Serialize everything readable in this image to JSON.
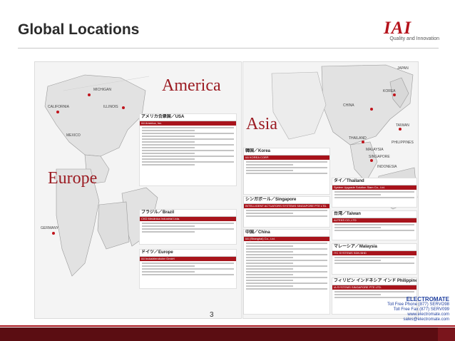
{
  "slide": {
    "title": "Global Locations",
    "page_number": "3",
    "brand_mark": "IAI",
    "brand_tagline": "Quality and Innovation"
  },
  "left_page": {
    "america_heading": "America",
    "europe_heading": "Europe",
    "map_labels": [
      "CALIFORNIA",
      "ILLINOIS",
      "MEXICO",
      "MICHIGAN",
      "GERMANY"
    ],
    "cards": [
      {
        "heading": "アメリカ合衆国／USA",
        "bar": "IAI America, Inc."
      },
      {
        "heading": "ブラジル／Brazil",
        "bar": "CKD Mecânica Industrial Ltda."
      },
      {
        "heading": "ドイツ／Europe",
        "bar": "IAI Industrieroboter GmbH"
      }
    ]
  },
  "right_page": {
    "asia_heading": "Asia",
    "map_labels": [
      "JAPAN",
      "KOREA",
      "CHINA",
      "TAIWAN",
      "THAILAND",
      "MALAYSIA",
      "PHILIPPINES",
      "SINGAPORE",
      "INDONESIA"
    ],
    "cards": [
      {
        "heading": "韓国／Korea",
        "bar": "IAI KOREA CORP."
      },
      {
        "heading": "シンガポール／Singapore",
        "bar": "INTELLIGENT ACTUATORS SYSTEMS SINGAPORE PTE LTD."
      },
      {
        "heading": "中国／China",
        "bar": "IAI (Shanghai) Co., Ltd."
      },
      {
        "heading": "タイ／Thailand",
        "bar": "System Upgrade Solution Siam Co., Ltd."
      },
      {
        "heading": "台湾／Taiwan",
        "bar": "ALTEKS CO.,LTD"
      },
      {
        "heading": "マレーシア／Malaysia",
        "bar": "ITC SYSTEMS SDN BHD"
      },
      {
        "heading": "フィリピン インドネシア インド Philippines Indonesia India",
        "bar": "IA SYSTEMS SINGAPORE PTE LTD."
      }
    ]
  },
  "electromate": {
    "name": "ELECTROMATE",
    "line1": "Toll Free Phone (877) SERVO98",
    "line2": "Toll Free Fax (877) SERV099",
    "line3": "www.electromate.com",
    "line4": "sales@electromate.com"
  }
}
